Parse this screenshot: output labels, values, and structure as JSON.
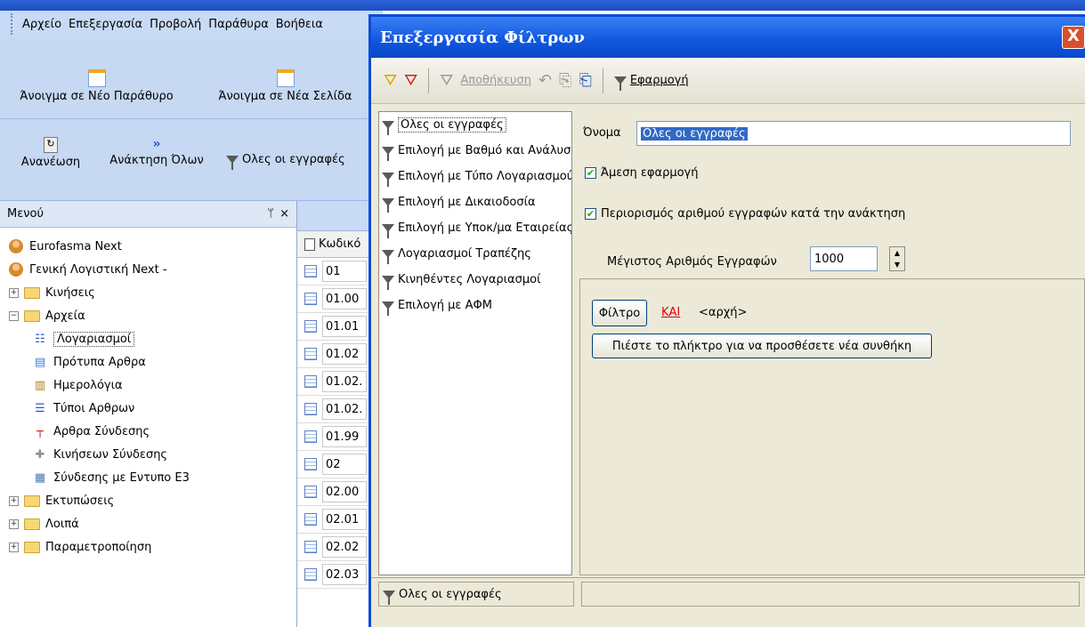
{
  "app": {
    "menu": [
      "Αρχείο",
      "Επεξεργασία",
      "Προβολή",
      "Παράθυρα",
      "Βοήθεια"
    ],
    "toolbar": {
      "open_new_window": "Άνοιγμα σε Νέο Παράθυρο",
      "open_new_page": "Άνοιγμα σε Νέα Σελίδα",
      "refresh": "Ανανέωση",
      "fetch_all": "Ανάκτηση Όλων",
      "filter_selector": "Ολες οι εγγραφές"
    },
    "menu_panel": {
      "title": "Μενού",
      "pin": "ᛘ",
      "close": "×",
      "tree": [
        {
          "label": "Eurofasma Next",
          "icon": "user-icon"
        },
        {
          "label": "Γενική Λογιστική Next -",
          "icon": "user-icon"
        },
        {
          "label": "Κινήσεις",
          "icon": "folder-icon",
          "expander": "+"
        },
        {
          "label": "Αρχεία",
          "icon": "folder-icon",
          "expander": "−"
        },
        {
          "label": "Λογαριασμοί",
          "icon": "list-icon"
        },
        {
          "label": "Πρότυπα Αρθρα",
          "icon": "document-icon"
        },
        {
          "label": "Ημερολόγια",
          "icon": "books-icon"
        },
        {
          "label": "Τύποι Αρθρων",
          "icon": "bullets-icon"
        },
        {
          "label": "Αρθρα Σύνδεσης",
          "icon": "tack-icon"
        },
        {
          "label": "Κινήσεων Σύνδεσης",
          "icon": "puzzle-icon"
        },
        {
          "label": "Σύνδεσης με Εντυπο Ε3",
          "icon": "form-icon"
        },
        {
          "label": "Εκτυπώσεις",
          "icon": "folder-icon",
          "expander": "+"
        },
        {
          "label": "Λοιπά",
          "icon": "folder-icon",
          "expander": "+"
        },
        {
          "label": "Παραμετροποίηση",
          "icon": "folder-icon",
          "expander": "+"
        }
      ]
    },
    "grid": {
      "column": "Κωδικό",
      "rows": [
        "01",
        "01.00",
        "01.01",
        "01.02",
        "01.02.",
        "01.02.",
        "01.99",
        "02",
        "02.00",
        "02.01",
        "02.02",
        "02.03"
      ]
    }
  },
  "dialog": {
    "title": "Επεξεργασία Φίλτρων",
    "close": "X",
    "toolbar": {
      "save": "Αποθήκευση",
      "apply": "Εφαρμογή"
    },
    "filters": [
      "Ολες οι εγγραφές",
      "Επιλογή με Βαθμό και Ανάλυση",
      "Επιλογή με Τύπο Λογαριασμού",
      "Επιλογή με Δικαιοδοσία",
      "Επιλογή με Υποκ/μα Εταιρείας",
      "Λογαριασμοί Τραπέζης",
      "Κινηθέντες Λογαριασμοί",
      "Επιλογή με ΑΦΜ"
    ],
    "name_label": "Όνομα",
    "name_value": "Ολες οι εγγραφές",
    "immediate_apply": {
      "label": "Άμεση εφαρμογή",
      "checked": true
    },
    "limit_records": {
      "label": "Περιορισμός αριθμού εγγραφών κατά την ανάκτηση",
      "checked": true
    },
    "max_label": "Μέγιστος Αριθμός Εγγραφών",
    "max_value": "1000",
    "builder": {
      "filter_button": "Φίλτρο",
      "and": "ΚΑΙ",
      "start": "<αρχή>",
      "add_condition": "Πιέστε το πλήκτρο για να προσθέσετε νέα συνθήκη"
    },
    "status": "Ολες οι εγγραφές"
  }
}
